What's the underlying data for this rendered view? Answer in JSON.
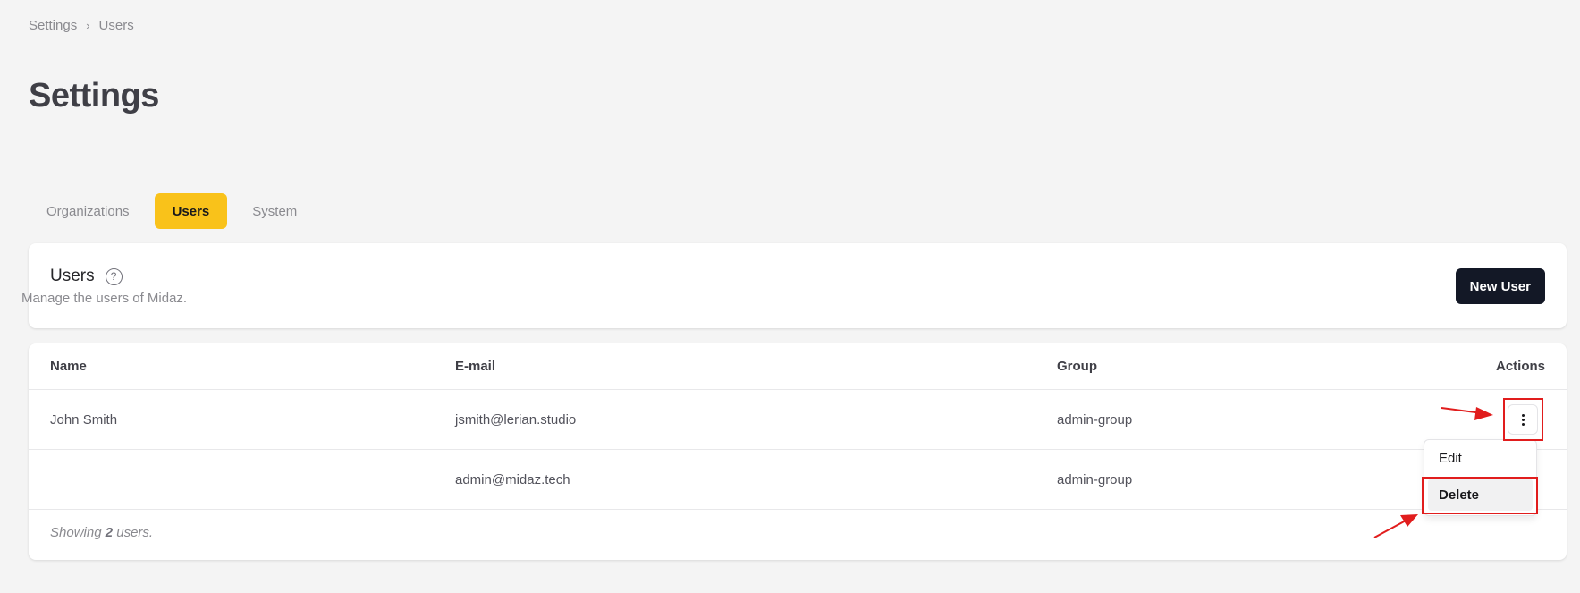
{
  "breadcrumb": {
    "items": [
      "Settings",
      "Users"
    ],
    "separator": "›"
  },
  "page": {
    "title": "Settings"
  },
  "tabs": [
    {
      "label": "Organizations",
      "active": false
    },
    {
      "label": "Users",
      "active": true
    },
    {
      "label": "System",
      "active": false
    }
  ],
  "header": {
    "title": "Users",
    "help_icon": "question-circle-icon",
    "subtitle": "Manage the users of Midaz.",
    "new_user_label": "New User"
  },
  "table": {
    "columns": [
      "Name",
      "E-mail",
      "Group",
      "Actions"
    ],
    "rows": [
      {
        "name": "John Smith",
        "email": "jsmith@lerian.studio",
        "group": "admin-group"
      },
      {
        "name": "",
        "email": "admin@midaz.tech",
        "group": "admin-group"
      }
    ],
    "footer": {
      "prefix": "Showing ",
      "count": "2",
      "suffix": " users."
    }
  },
  "actions_menu": {
    "trigger_icon": "more-vertical-icon",
    "items": [
      "Edit",
      "Delete"
    ]
  },
  "colors": {
    "accent": "#f9c21a",
    "primary_button": "#131826",
    "annotation": "#e11d1d"
  }
}
